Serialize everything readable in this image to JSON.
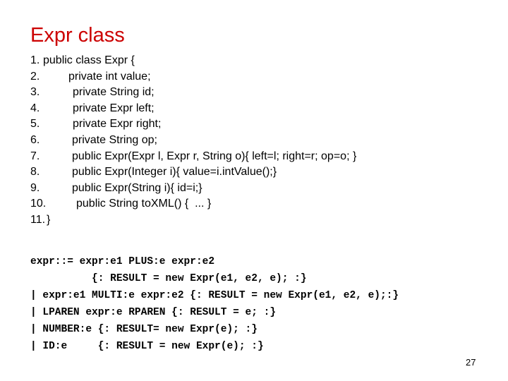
{
  "slide": {
    "title": "Expr class",
    "title_color": "#cc0000",
    "page_number": "27"
  },
  "java_code": {
    "lines": [
      {
        "num": "1.",
        "text": "public class Expr {"
      },
      {
        "num": "2.",
        "text": "private int value;"
      },
      {
        "num": "3.",
        "text": "private String id;"
      },
      {
        "num": "4.",
        "text": "private Expr left;"
      },
      {
        "num": "5.",
        "text": "private Expr right;"
      },
      {
        "num": "6.",
        "text": "private String op;"
      },
      {
        "num": "7.",
        "text": "public Expr(Expr l, Expr r, String o){ left=l; right=r; op=o; }"
      },
      {
        "num": "8.",
        "text": "public Expr(Integer i){ value=i.intValue();}"
      },
      {
        "num": "9.",
        "text": "public Expr(String i){ id=i;}"
      },
      {
        "num": "10.",
        "text": "public String toXML() {  ... }"
      },
      {
        "num": "11.",
        "text": "}"
      }
    ]
  },
  "grammar": {
    "lines": [
      "expr::= expr:e1 PLUS:e expr:e2",
      "          {: RESULT = new Expr(e1, e2, e); :}",
      "| expr:e1 MULTI:e expr:e2 {: RESULT = new Expr(e1, e2, e);:}",
      "| LPAREN expr:e RPAREN {: RESULT = e; :}",
      "| NUMBER:e {: RESULT= new Expr(e); :}",
      "| ID:e     {: RESULT = new Expr(e); :}"
    ]
  }
}
